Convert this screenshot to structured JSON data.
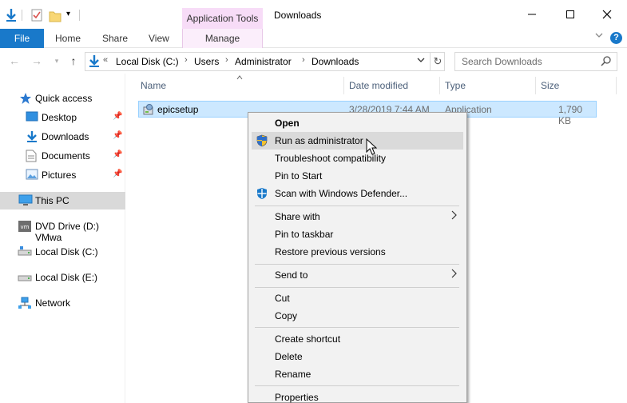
{
  "window": {
    "title": "Downloads",
    "contextual_tab_group": "Application Tools",
    "minimize_icon": "minimize-icon",
    "maximize_icon": "maximize-icon",
    "close_icon": "close-icon"
  },
  "ribbon": {
    "file": "File",
    "tabs": [
      "Home",
      "Share",
      "View"
    ],
    "manage": "Manage"
  },
  "address": {
    "overflow": "«",
    "crumbs": [
      "Local Disk (C:)",
      "Users",
      "Administrator",
      "Downloads"
    ]
  },
  "search": {
    "placeholder": "Search Downloads"
  },
  "nav": {
    "quick_access": "Quick access",
    "pinned": [
      "Desktop",
      "Downloads",
      "Documents",
      "Pictures"
    ],
    "this_pc": "This PC",
    "drives": [
      "DVD Drive (D:) VMwa",
      "Local Disk (C:)",
      "Local Disk (E:)"
    ],
    "network": "Network"
  },
  "columns": {
    "name": "Name",
    "date": "Date modified",
    "type": "Type",
    "size": "Size"
  },
  "file": {
    "name": "epicsetup",
    "date": "3/28/2019 7:44 AM",
    "type": "Application",
    "size": "1,790 KB"
  },
  "context_menu": {
    "open": "Open",
    "run_as_admin": "Run as administrator",
    "troubleshoot": "Troubleshoot compatibility",
    "pin_start": "Pin to Start",
    "scan": "Scan with Windows Defender...",
    "share_with": "Share with",
    "pin_taskbar": "Pin to taskbar",
    "restore": "Restore previous versions",
    "send_to": "Send to",
    "cut": "Cut",
    "copy": "Copy",
    "create_shortcut": "Create shortcut",
    "delete": "Delete",
    "rename": "Rename",
    "properties": "Properties"
  },
  "colors": {
    "accent": "#1979ca",
    "selection": "#cce8ff",
    "contextual_tab": "#f7dcf7"
  }
}
